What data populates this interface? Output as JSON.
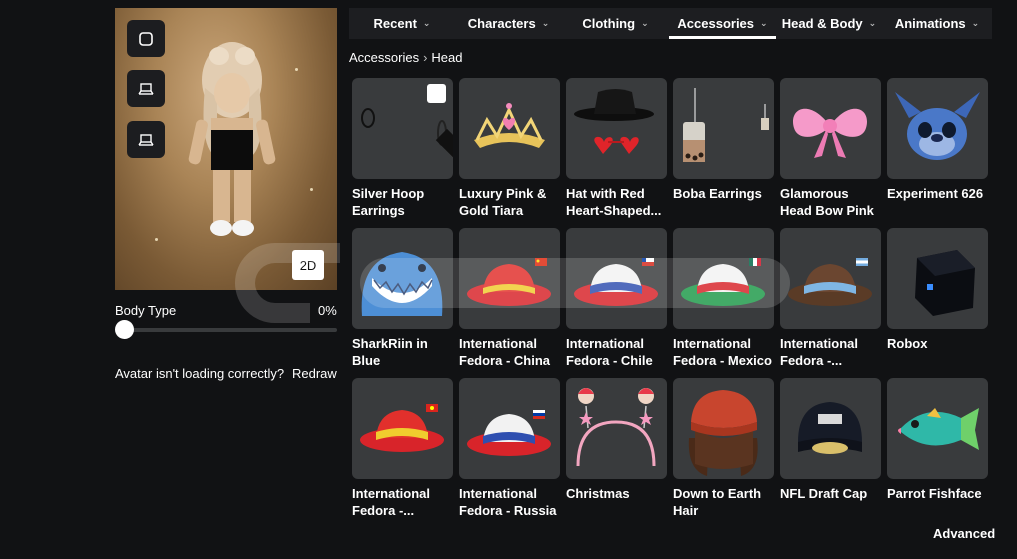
{
  "avatar": {
    "view_toggle": "2D",
    "body_type_label": "Body Type",
    "body_type_value": "0%",
    "body_type_fraction": 0,
    "loading_text": "Avatar isn't loading correctly?",
    "redraw_label": "Redraw"
  },
  "tabs": [
    {
      "label": "Recent",
      "active": false
    },
    {
      "label": "Characters",
      "active": false
    },
    {
      "label": "Clothing",
      "active": false
    },
    {
      "label": "Accessories",
      "active": true
    },
    {
      "label": "Head & Body",
      "active": false
    },
    {
      "label": "Animations",
      "active": false
    }
  ],
  "breadcrumb": {
    "parent": "Accessories",
    "current": "Head"
  },
  "items": [
    {
      "name": "Silver Hoop Earrings",
      "icon": "hoop-earrings-icon",
      "selected": true
    },
    {
      "name": "Luxury Pink & Gold Tiara",
      "icon": "tiara-icon",
      "selected": false
    },
    {
      "name": "Hat with Red Heart-Shaped...",
      "icon": "hat-glasses-icon",
      "selected": false
    },
    {
      "name": "Boba Earrings",
      "icon": "boba-earrings-icon",
      "selected": false
    },
    {
      "name": "Glamorous Head Bow Pink",
      "icon": "pink-bow-icon",
      "selected": false
    },
    {
      "name": "Experiment 626",
      "icon": "stitch-head-icon",
      "selected": false
    },
    {
      "name": "SharkRiin in Blue",
      "icon": "shark-hood-icon",
      "selected": false
    },
    {
      "name": "International Fedora - China",
      "icon": "fedora-china-icon",
      "selected": false
    },
    {
      "name": "International Fedora - Chile",
      "icon": "fedora-chile-icon",
      "selected": false
    },
    {
      "name": "International Fedora - Mexico",
      "icon": "fedora-mexico-icon",
      "selected": false
    },
    {
      "name": "International Fedora -...",
      "icon": "fedora-argentina-icon",
      "selected": false
    },
    {
      "name": "Robox",
      "icon": "robox-icon",
      "selected": false
    },
    {
      "name": "International Fedora -...",
      "icon": "fedora-vietnam-icon",
      "selected": false
    },
    {
      "name": "International Fedora - Russia",
      "icon": "fedora-russia-icon",
      "selected": false
    },
    {
      "name": "Christmas",
      "icon": "christmas-headband-icon",
      "selected": false
    },
    {
      "name": "Down to Earth Hair",
      "icon": "beanie-hair-icon",
      "selected": false
    },
    {
      "name": "NFL Draft Cap",
      "icon": "nfl-cap-icon",
      "selected": false
    },
    {
      "name": "Parrot Fishface",
      "icon": "parrot-fish-icon",
      "selected": false
    }
  ],
  "advanced_label": "Advanced",
  "colors": {
    "background": "#111214",
    "tile": "#393b3d",
    "tabbar": "#1d1e21",
    "text": "#ffffff"
  }
}
